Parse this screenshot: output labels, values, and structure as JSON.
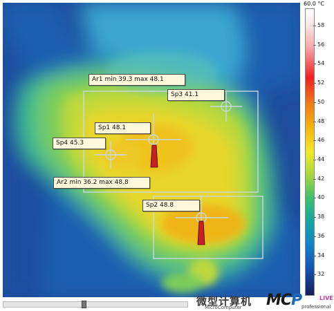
{
  "spots": {
    "sp1": "Sp1 48.1",
    "sp2": "Sp2 48.8",
    "sp3": "Sp3 41.1",
    "sp4": "Sp4 45.3"
  },
  "areas": {
    "ar1": "Ar1 min 39.3 max 48.1",
    "ar2": "Ar2 min 36.2 max 48.8"
  },
  "scale": {
    "title": "60.0 °C",
    "ticks": [
      "58",
      "56",
      "54",
      "52",
      "50",
      "48",
      "46",
      "44",
      "42",
      "40",
      "38",
      "36",
      "34",
      "32"
    ]
  },
  "watermark": {
    "cn": "微型计算机",
    "en": "MicroComputer",
    "logo_a": "MC",
    "logo_b": "P",
    "logo_c": "LIVE",
    "pro": "professional"
  },
  "colors": {
    "marker": "#c8d8e2",
    "hot": "#ee2020",
    "background": "#1f4d9a"
  }
}
